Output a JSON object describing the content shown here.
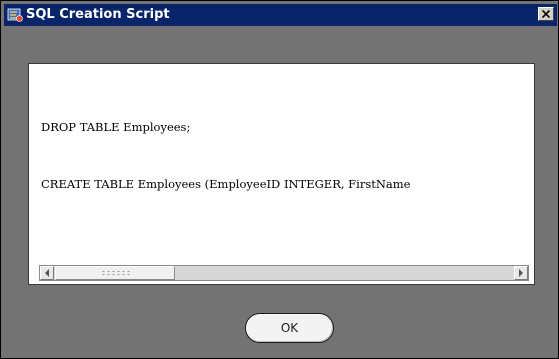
{
  "window": {
    "title": "SQL Creation Script",
    "app_icon": "java-app-icon",
    "close_icon": "close-icon",
    "accent": "#0a246a"
  },
  "script": {
    "lines": [
      "DROP TABLE Employees;",
      "CREATE TABLE Employees (EmployeeID INTEGER, FirstName"
    ]
  },
  "scrollbar": {
    "left_icon": "arrow-left-icon",
    "right_icon": "arrow-right-icon"
  },
  "buttons": {
    "ok_label": "OK"
  }
}
